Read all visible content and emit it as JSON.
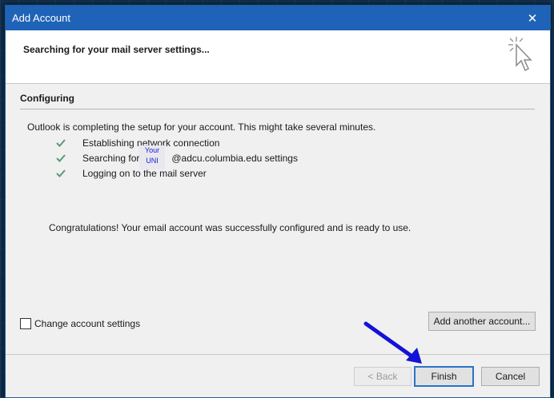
{
  "window": {
    "title": "Add Account",
    "close_glyph": "✕"
  },
  "header": {
    "heading": "Searching for your mail server settings...",
    "art_icon": "busy-cursor-icon"
  },
  "main": {
    "section_label": "Configuring",
    "intro": "Outlook is completing the setup for your account. This might take several minutes.",
    "steps": [
      {
        "label": "Establishing network connection",
        "status": "done"
      },
      {
        "label_prefix": "Searching for",
        "label_suffix": "@adcu.columbia.edu settings",
        "status": "done"
      },
      {
        "label": "Logging on to the mail server",
        "status": "done"
      }
    ],
    "uni_note": {
      "line1": "Your",
      "line2": "UNI"
    },
    "congrats": "Congratulations! Your email account was successfully configured and is ready to use."
  },
  "options": {
    "change_settings_label": "Change account settings",
    "change_settings_checked": false,
    "add_another_label": "Add another account..."
  },
  "footer": {
    "back_label": "< Back",
    "finish_label": "Finish",
    "cancel_label": "Cancel"
  },
  "colors": {
    "titlebar": "#1f63b8",
    "check": "#5a9a78",
    "annotation_arrow": "#1212d8",
    "focus_border": "#2a73c8"
  }
}
